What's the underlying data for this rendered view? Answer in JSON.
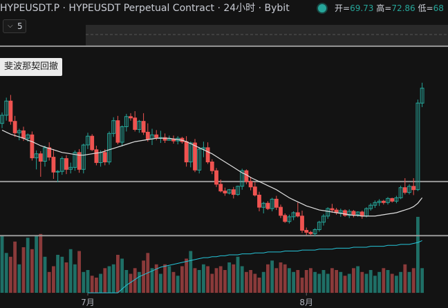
{
  "header": {
    "title": "HYPEUSDT.P · HYPEUSDT Perpetual Contract · 24小时 · Bybit",
    "status_color": "#26a69a",
    "ohlc": [
      {
        "label": "开=",
        "value": "69.73"
      },
      {
        "label": "高=",
        "value": "72.86"
      },
      {
        "label": "低=",
        "value": "68"
      }
    ]
  },
  "interval_toggle": {
    "icon": "chevron-down-icon",
    "value": "5"
  },
  "fib_label": "斐波那契回撤",
  "colors": {
    "up": "#26a69a",
    "down": "#ef5350",
    "up_vol": "#1f6f66",
    "down_vol": "#8a3a3a",
    "ma": "#e0e0e0",
    "vol_ma": "#26c6da"
  },
  "chart_data": {
    "type": "candlestick",
    "x_ticks": [
      {
        "index": 20,
        "label": "7月"
      },
      {
        "index": 71,
        "label": "8月"
      }
    ],
    "candles": [
      [
        54.6,
        56.2,
        53.9,
        55.8
      ],
      [
        55.8,
        58.4,
        55.0,
        57.9
      ],
      [
        57.9,
        58.8,
        54.4,
        54.9
      ],
      [
        54.9,
        55.7,
        52.6,
        53.2
      ],
      [
        53.2,
        53.8,
        52.1,
        53.5
      ],
      [
        53.5,
        54.1,
        52.0,
        52.4
      ],
      [
        52.4,
        53.1,
        51.9,
        52.9
      ],
      [
        52.9,
        53.4,
        49.1,
        49.5
      ],
      [
        49.5,
        50.6,
        47.8,
        50.1
      ],
      [
        50.1,
        50.5,
        46.7,
        49.0
      ],
      [
        49.0,
        51.3,
        48.2,
        51.0
      ],
      [
        51.0,
        51.8,
        49.1,
        49.6
      ],
      [
        49.6,
        50.8,
        46.4,
        47.4
      ],
      [
        47.4,
        47.7,
        45.9,
        47.5
      ],
      [
        47.5,
        49.7,
        47.0,
        49.4
      ],
      [
        49.4,
        49.9,
        47.1,
        47.8
      ],
      [
        47.8,
        48.8,
        47.2,
        48.1
      ],
      [
        48.1,
        50.6,
        47.6,
        50.3
      ],
      [
        50.3,
        50.8,
        47.3,
        47.8
      ],
      [
        47.8,
        51.6,
        47.2,
        51.4
      ],
      [
        51.4,
        53.2,
        50.8,
        52.7
      ],
      [
        52.7,
        53.0,
        50.5,
        50.7
      ],
      [
        50.7,
        51.3,
        48.4,
        48.8
      ],
      [
        48.8,
        50.6,
        48.2,
        50.3
      ],
      [
        50.3,
        50.8,
        48.4,
        48.9
      ],
      [
        48.9,
        53.4,
        48.5,
        53.1
      ],
      [
        53.1,
        55.5,
        52.6,
        55.0
      ],
      [
        55.0,
        55.7,
        51.5,
        51.8
      ],
      [
        51.8,
        54.3,
        51.2,
        54.1
      ],
      [
        54.1,
        56.0,
        53.4,
        55.6
      ],
      [
        55.6,
        56.1,
        55.0,
        55.4
      ],
      [
        55.4,
        56.4,
        53.4,
        53.7
      ],
      [
        53.7,
        55.1,
        53.2,
        54.9
      ],
      [
        54.9,
        56.1,
        52.9,
        53.3
      ],
      [
        53.3,
        54.6,
        51.9,
        52.3
      ],
      [
        52.3,
        53.8,
        51.4,
        52.9
      ],
      [
        52.9,
        53.6,
        52.1,
        52.5
      ],
      [
        52.5,
        53.5,
        51.7,
        52.5
      ],
      [
        52.5,
        53.1,
        51.7,
        52.1
      ],
      [
        52.1,
        52.8,
        52.1,
        52.3
      ],
      [
        52.3,
        52.8,
        51.6,
        52.0
      ],
      [
        52.0,
        52.7,
        51.5,
        52.4
      ],
      [
        52.4,
        52.6,
        51.6,
        51.9
      ],
      [
        51.9,
        52.7,
        48.2,
        48.9
      ],
      [
        48.9,
        51.9,
        48.1,
        51.7
      ],
      [
        51.7,
        52.3,
        47.4,
        47.7
      ],
      [
        47.7,
        51.1,
        47.2,
        50.8
      ],
      [
        50.8,
        51.9,
        49.6,
        51.0
      ],
      [
        51.0,
        51.8,
        48.6,
        48.9
      ],
      [
        48.9,
        49.3,
        47.1,
        47.6
      ],
      [
        47.6,
        48.0,
        45.2,
        45.6
      ],
      [
        45.6,
        46.3,
        44.4,
        44.6
      ],
      [
        44.6,
        45.1,
        43.9,
        44.3
      ],
      [
        44.3,
        44.9,
        44.1,
        44.8
      ],
      [
        44.8,
        45.2,
        43.5,
        44.1
      ],
      [
        44.1,
        45.4,
        43.9,
        45.3
      ],
      [
        45.3,
        47.9,
        44.8,
        47.6
      ],
      [
        47.6,
        47.8,
        45.6,
        46.0
      ],
      [
        46.0,
        46.7,
        44.7,
        45.2
      ],
      [
        45.2,
        45.9,
        43.8,
        44.0
      ],
      [
        44.0,
        44.5,
        41.6,
        42.2
      ],
      [
        42.2,
        43.0,
        41.3,
        42.8
      ],
      [
        42.8,
        43.1,
        41.8,
        42.0
      ],
      [
        42.0,
        43.6,
        41.6,
        43.4
      ],
      [
        43.4,
        43.9,
        41.8,
        42.2
      ],
      [
        42.2,
        42.6,
        40.6,
        41.0
      ],
      [
        41.0,
        41.3,
        39.9,
        40.1
      ],
      [
        40.1,
        41.1,
        39.8,
        40.8
      ],
      [
        40.8,
        41.6,
        40.3,
        41.4
      ],
      [
        41.4,
        42.9,
        40.7,
        40.9
      ],
      [
        40.9,
        41.7,
        38.4,
        38.8
      ],
      [
        38.8,
        39.2,
        38.1,
        38.5
      ],
      [
        38.5,
        38.7,
        38.1,
        38.3
      ],
      [
        38.3,
        39.1,
        37.9,
        38.9
      ],
      [
        38.9,
        40.2,
        38.6,
        40.0
      ],
      [
        40.0,
        41.2,
        39.5,
        40.9
      ],
      [
        40.9,
        42.2,
        40.5,
        42.0
      ],
      [
        42.0,
        42.7,
        41.4,
        41.8
      ],
      [
        41.8,
        42.1,
        41.1,
        41.4
      ],
      [
        41.4,
        42.0,
        40.8,
        41.7
      ],
      [
        41.7,
        41.9,
        40.8,
        41.0
      ],
      [
        41.0,
        41.9,
        40.6,
        41.6
      ],
      [
        41.6,
        41.8,
        40.7,
        41.1
      ],
      [
        41.1,
        41.6,
        40.8,
        41.5
      ],
      [
        41.5,
        41.7,
        40.5,
        40.9
      ],
      [
        40.9,
        42.2,
        40.7,
        42.0
      ],
      [
        42.0,
        42.8,
        41.7,
        42.5
      ],
      [
        42.5,
        43.2,
        42.1,
        42.9
      ],
      [
        42.9,
        43.4,
        42.4,
        43.1
      ],
      [
        43.1,
        43.3,
        42.6,
        42.9
      ],
      [
        42.9,
        43.7,
        42.6,
        43.5
      ],
      [
        43.5,
        43.6,
        42.9,
        43.1
      ],
      [
        43.1,
        43.9,
        42.8,
        43.6
      ],
      [
        43.6,
        45.4,
        43.4,
        45.1
      ],
      [
        45.1,
        46.5,
        44.1,
        44.4
      ],
      [
        44.4,
        45.6,
        44.1,
        45.3
      ],
      [
        45.3,
        46.5,
        44.0,
        44.8
      ],
      [
        44.8,
        58.1,
        44.6,
        57.6
      ],
      [
        57.6,
        60.6,
        57.0,
        59.8
      ]
    ],
    "ma": [
      53.6,
      53.3,
      53.0,
      52.8,
      52.6,
      52.4,
      52.1,
      51.9,
      51.6,
      51.3,
      51.1,
      50.9,
      50.7,
      50.5,
      50.3,
      50.2,
      50.1,
      50.0,
      49.9,
      49.9,
      50.0,
      50.1,
      50.2,
      50.3,
      50.5,
      50.7,
      50.9,
      51.1,
      51.3,
      51.5,
      51.7,
      51.9,
      52.0,
      52.1,
      52.2,
      52.3,
      52.4,
      52.4,
      52.4,
      52.4,
      52.3,
      52.2,
      52.1,
      51.9,
      51.6,
      51.3,
      51.0,
      50.7,
      50.4,
      50.1,
      49.7,
      49.3,
      48.9,
      48.5,
      48.1,
      47.7,
      47.3,
      47.0,
      46.6,
      46.3,
      46.0,
      45.7,
      45.4,
      45.1,
      44.8,
      44.4,
      44.0,
      43.6,
      43.3,
      43.0,
      42.7,
      42.4,
      42.2,
      42.0,
      41.8,
      41.7,
      41.6,
      41.5,
      41.4,
      41.3,
      41.2,
      41.1,
      41.0,
      41.0,
      40.9,
      40.9,
      40.9,
      40.9,
      41.0,
      41.1,
      41.2,
      41.3,
      41.4,
      41.6,
      41.8,
      42.0,
      42.3,
      42.8,
      43.6
    ],
    "volume": [
      60,
      42,
      38,
      54,
      30,
      48,
      58,
      46,
      60,
      62,
      38,
      22,
      28,
      40,
      38,
      32,
      46,
      30,
      44,
      22,
      24,
      18,
      16,
      20,
      26,
      28,
      30,
      40,
      36,
      24,
      20,
      26,
      22,
      34,
      42,
      26,
      30,
      20,
      30,
      28,
      22,
      18,
      28,
      36,
      44,
      26,
      24,
      30,
      28,
      20,
      26,
      28,
      24,
      32,
      30,
      38,
      28,
      22,
      24,
      20,
      16,
      22,
      30,
      34,
      26,
      32,
      30,
      26,
      22,
      24,
      16,
      24,
      26,
      22,
      20,
      24,
      20,
      26,
      24,
      22,
      18,
      20,
      26,
      28,
      22,
      20,
      24,
      18,
      22,
      26,
      24,
      20,
      18,
      22,
      30,
      22,
      26,
      80,
      26
    ],
    "vol_ma": [
      3,
      3,
      3,
      3,
      3,
      3,
      3,
      3,
      3,
      3,
      3,
      3,
      3,
      3,
      3,
      3,
      3,
      3,
      3,
      3,
      0,
      0,
      0,
      0,
      0,
      0,
      0,
      0,
      4,
      8,
      11,
      14,
      17,
      19,
      21,
      23,
      25,
      27,
      28,
      29,
      30,
      31,
      32,
      33,
      34,
      35,
      36,
      37,
      37,
      38,
      38,
      39,
      39,
      40,
      40,
      40,
      41,
      41,
      41,
      42,
      42,
      42,
      43,
      43,
      43,
      43,
      44,
      44,
      44,
      44,
      45,
      45,
      45,
      45,
      46,
      46,
      46,
      46,
      47,
      47,
      47,
      47,
      48,
      48,
      48,
      48,
      49,
      49,
      49,
      49,
      50,
      50,
      50,
      51,
      51,
      51,
      52,
      53,
      55
    ],
    "horizontal_lines": [
      66.0,
      46.0,
      38.0
    ],
    "ylim": [
      36.5,
      66.5
    ]
  }
}
